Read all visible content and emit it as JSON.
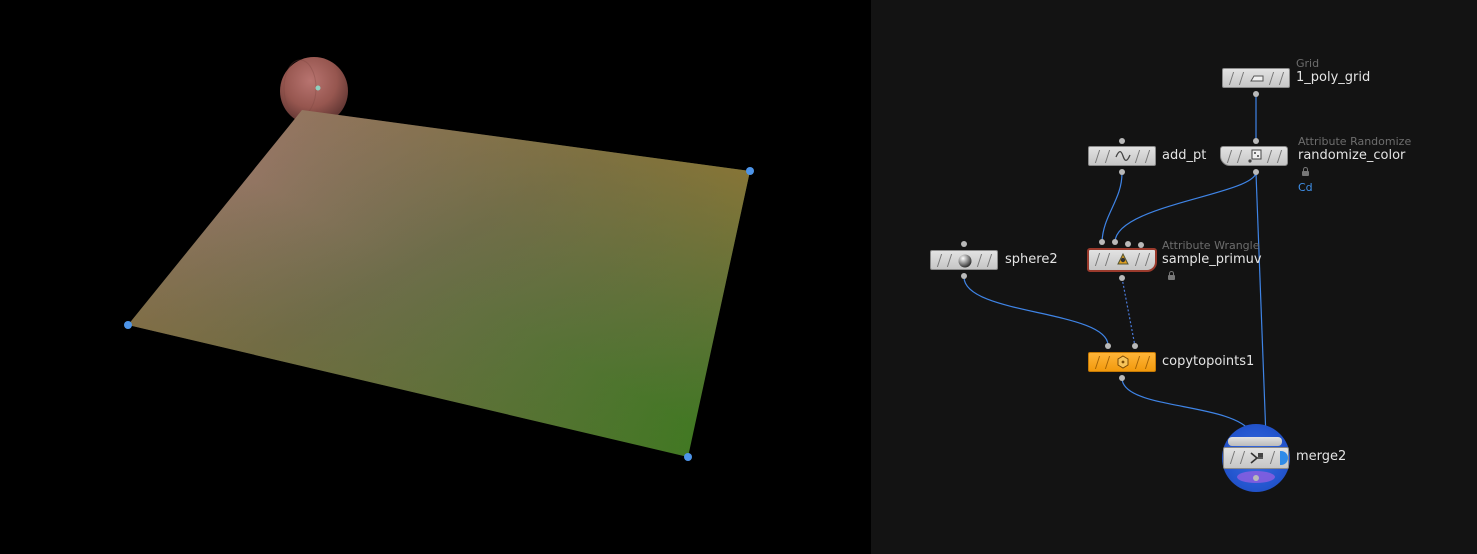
{
  "viewport": {
    "plane_colors": [
      "#a97a73",
      "#6b6a44",
      "#3c7a1d",
      "#8c6a28"
    ],
    "sphere_color": "#9a5c58",
    "handle_color": "#4d94e8"
  },
  "network": {
    "nodes": {
      "grid": {
        "type": "Grid",
        "name": "1_poly_grid"
      },
      "add_pt": {
        "name": "add_pt"
      },
      "randomize": {
        "type": "Attribute Randomize",
        "name": "randomize_color",
        "attr": "Cd"
      },
      "sphere": {
        "name": "sphere2"
      },
      "wrangle": {
        "type": "Attribute Wrangle",
        "name": "sample_primuv"
      },
      "copy": {
        "name": "copytopoints1"
      },
      "merge": {
        "name": "merge2"
      }
    },
    "colors": {
      "wire": "#3f84e6",
      "node_body": "#d4d4d4",
      "copy_node": "#f5a11a",
      "merge_ring": "#2456cf",
      "background": "#131313"
    },
    "icons": {
      "grid": "grid-icon",
      "add_pt": "wave-icon",
      "randomize": "dice-icon",
      "sphere": "sphere-icon",
      "wrangle": "wrangle-icon",
      "copy": "copy-points-icon",
      "merge": "merge-icon"
    }
  }
}
